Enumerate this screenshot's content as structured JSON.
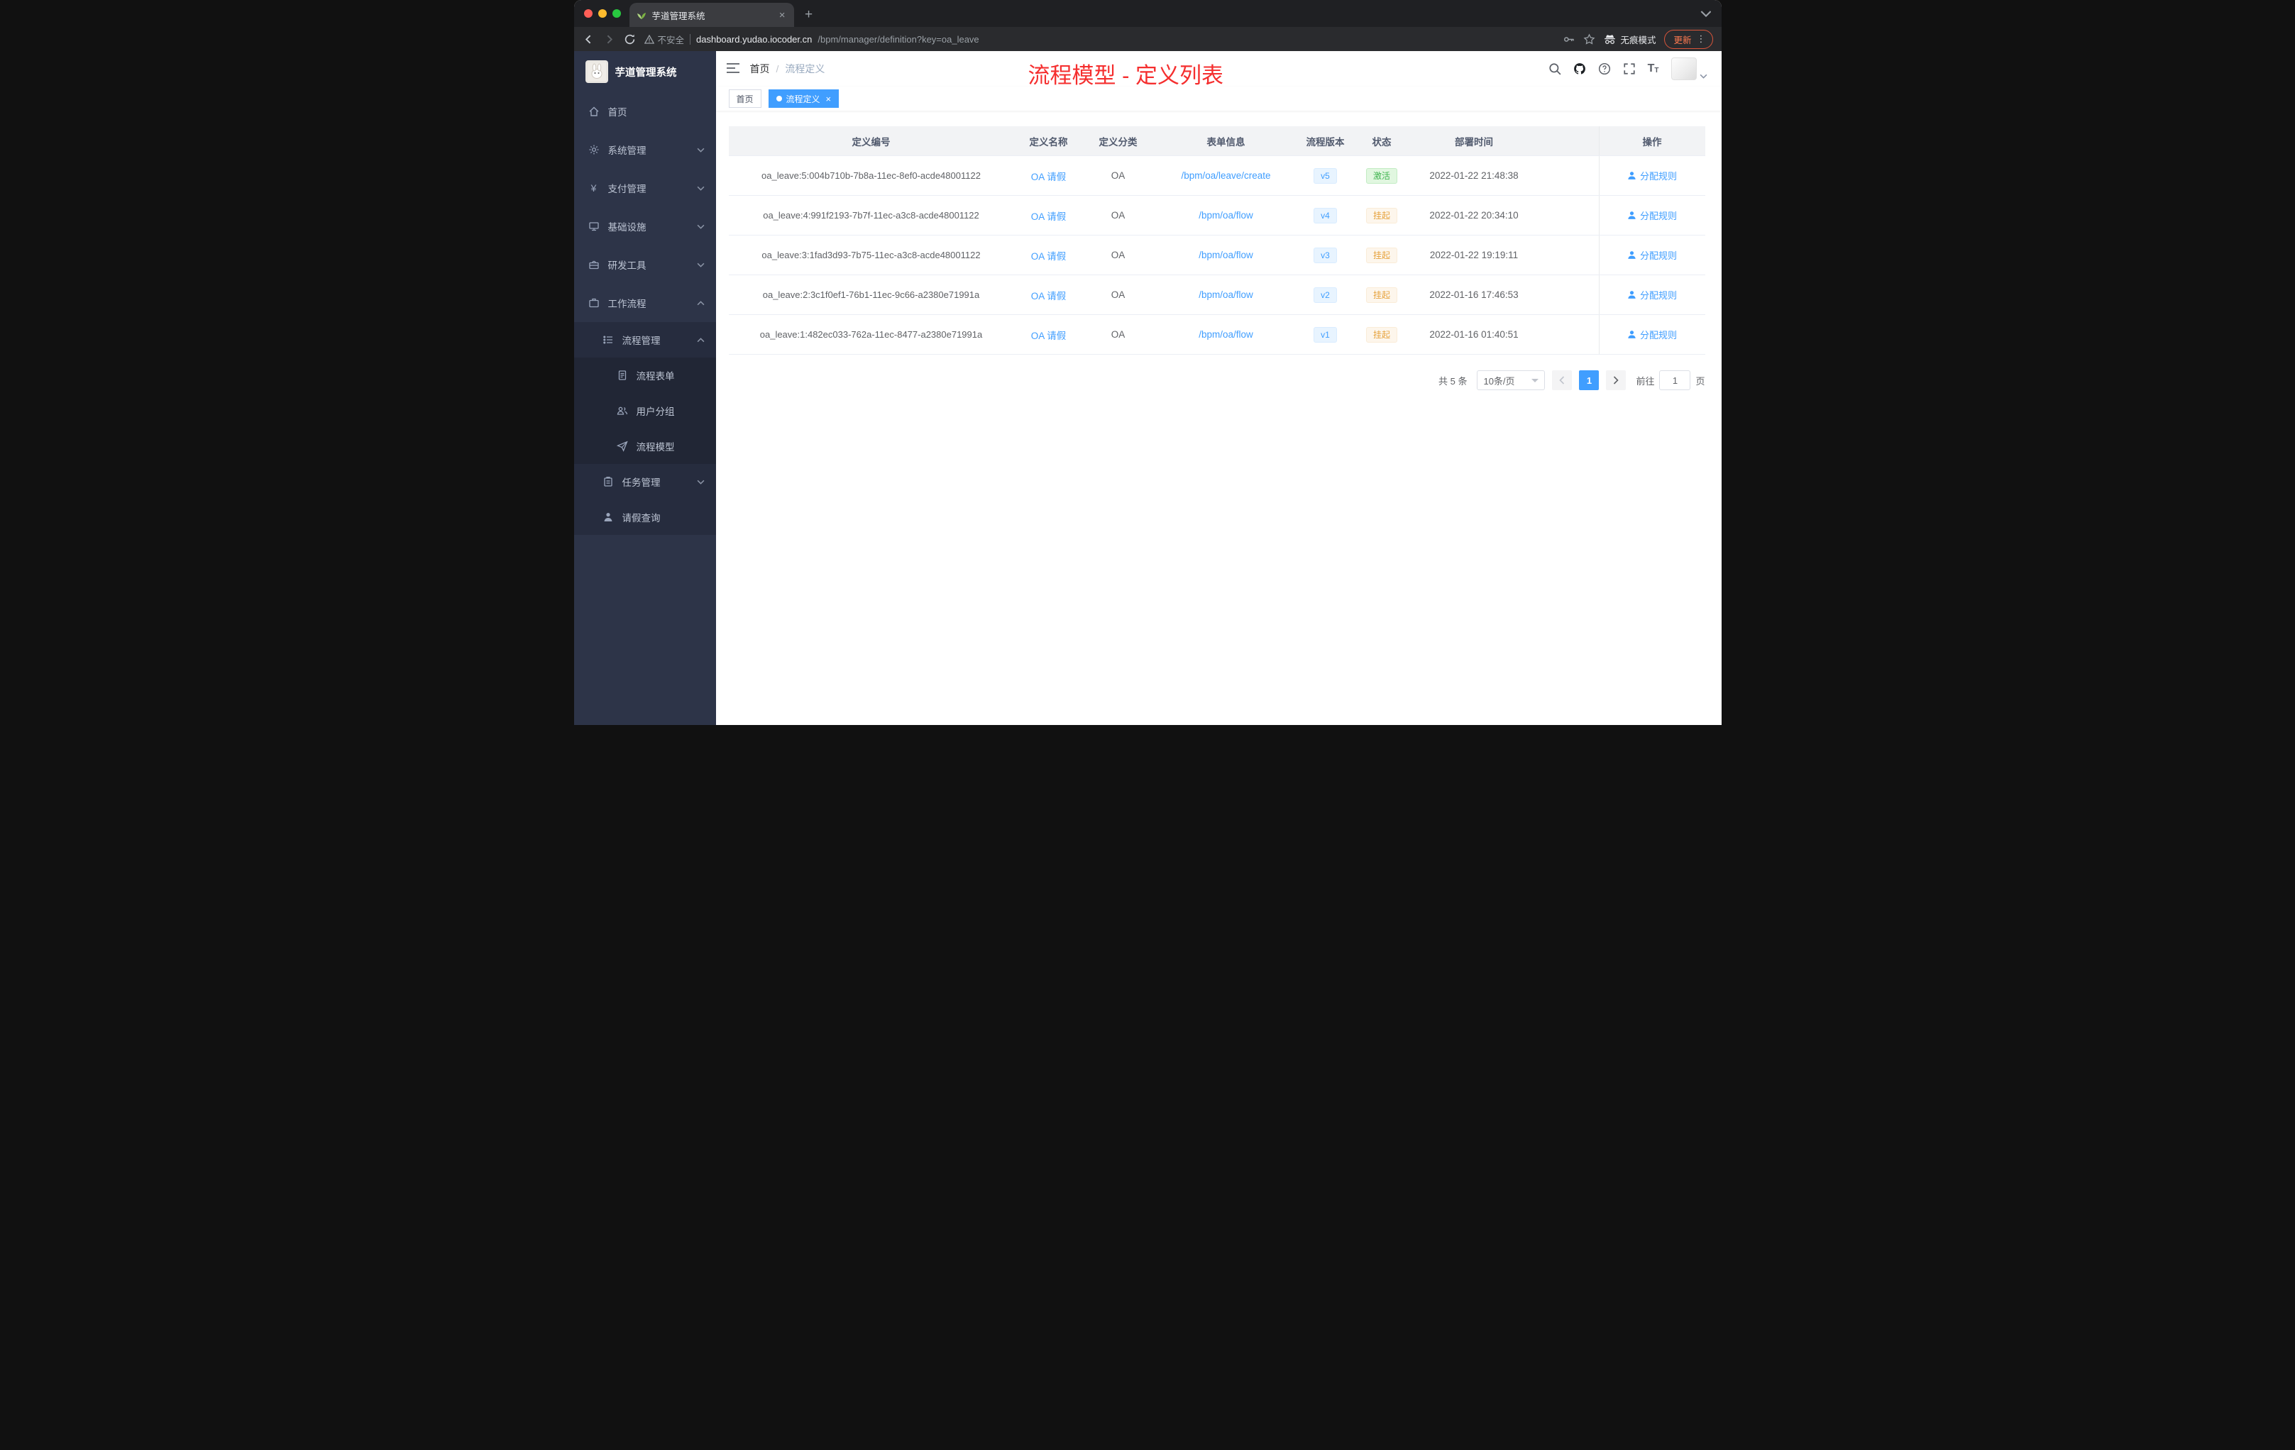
{
  "browser": {
    "tab_title": "芋道管理系统",
    "new_tab_label": "+",
    "close_tab_label": "×",
    "security_label": "不安全",
    "url_host": "dashboard.yudao.iocoder.cn",
    "url_path": "/bpm/manager/definition?key=oa_leave",
    "incognito_label": "无痕模式",
    "update_label": "更新",
    "menu_dots": "⋮"
  },
  "sidebar": {
    "logo_title": "芋道管理系统",
    "items": [
      {
        "label": "首页"
      },
      {
        "label": "系统管理"
      },
      {
        "label": "支付管理"
      },
      {
        "label": "基础设施"
      },
      {
        "label": "研发工具"
      },
      {
        "label": "工作流程",
        "children": [
          {
            "label": "流程管理",
            "children": [
              {
                "label": "流程表单"
              },
              {
                "label": "用户分组"
              },
              {
                "label": "流程模型"
              }
            ]
          },
          {
            "label": "任务管理"
          },
          {
            "label": "请假查询"
          }
        ]
      }
    ]
  },
  "header": {
    "breadcrumb": {
      "home": "首页",
      "separator": "/",
      "current": "流程定义"
    },
    "annotation": "流程模型 - 定义列表"
  },
  "tags": {
    "items": [
      {
        "label": "首页",
        "active": false
      },
      {
        "label": "流程定义",
        "active": true,
        "close": "×"
      }
    ]
  },
  "table": {
    "columns": [
      "定义编号",
      "定义名称",
      "定义分类",
      "表单信息",
      "流程版本",
      "状态",
      "部署时间",
      "操作"
    ],
    "rows": [
      {
        "id": "oa_leave:5:004b710b-7b8a-11ec-8ef0-acde48001122",
        "name": "OA 请假",
        "category": "OA",
        "form": "/bpm/oa/leave/create",
        "version": "v5",
        "status": "激活",
        "status_type": "success",
        "deploy_time": "2022-01-22 21:48:38",
        "action": "分配规则"
      },
      {
        "id": "oa_leave:4:991f2193-7b7f-11ec-a3c8-acde48001122",
        "name": "OA 请假",
        "category": "OA",
        "form": "/bpm/oa/flow",
        "version": "v4",
        "status": "挂起",
        "status_type": "warning",
        "deploy_time": "2022-01-22 20:34:10",
        "action": "分配规则"
      },
      {
        "id": "oa_leave:3:1fad3d93-7b75-11ec-a3c8-acde48001122",
        "name": "OA 请假",
        "category": "OA",
        "form": "/bpm/oa/flow",
        "version": "v3",
        "status": "挂起",
        "status_type": "warning",
        "deploy_time": "2022-01-22 19:19:11",
        "action": "分配规则"
      },
      {
        "id": "oa_leave:2:3c1f0ef1-76b1-11ec-9c66-a2380e71991a",
        "name": "OA 请假",
        "category": "OA",
        "form": "/bpm/oa/flow",
        "version": "v2",
        "status": "挂起",
        "status_type": "warning",
        "deploy_time": "2022-01-16 17:46:53",
        "action": "分配规则"
      },
      {
        "id": "oa_leave:1:482ec033-762a-11ec-8477-a2380e71991a",
        "name": "OA 请假",
        "category": "OA",
        "form": "/bpm/oa/flow",
        "version": "v1",
        "status": "挂起",
        "status_type": "warning",
        "deploy_time": "2022-01-16 01:40:51",
        "action": "分配规则"
      }
    ]
  },
  "pagination": {
    "total": "共 5 条",
    "page_size": "10条/页",
    "current_page": "1",
    "goto_label": "前往",
    "goto_value": "1",
    "goto_unit": "页"
  },
  "colors": {
    "accent": "#409eff",
    "annotation_red": "#f52e2e",
    "success_green": "#3eb44e",
    "warning_orange": "#e6a23c",
    "sidebar_bg": "#2d3448"
  }
}
